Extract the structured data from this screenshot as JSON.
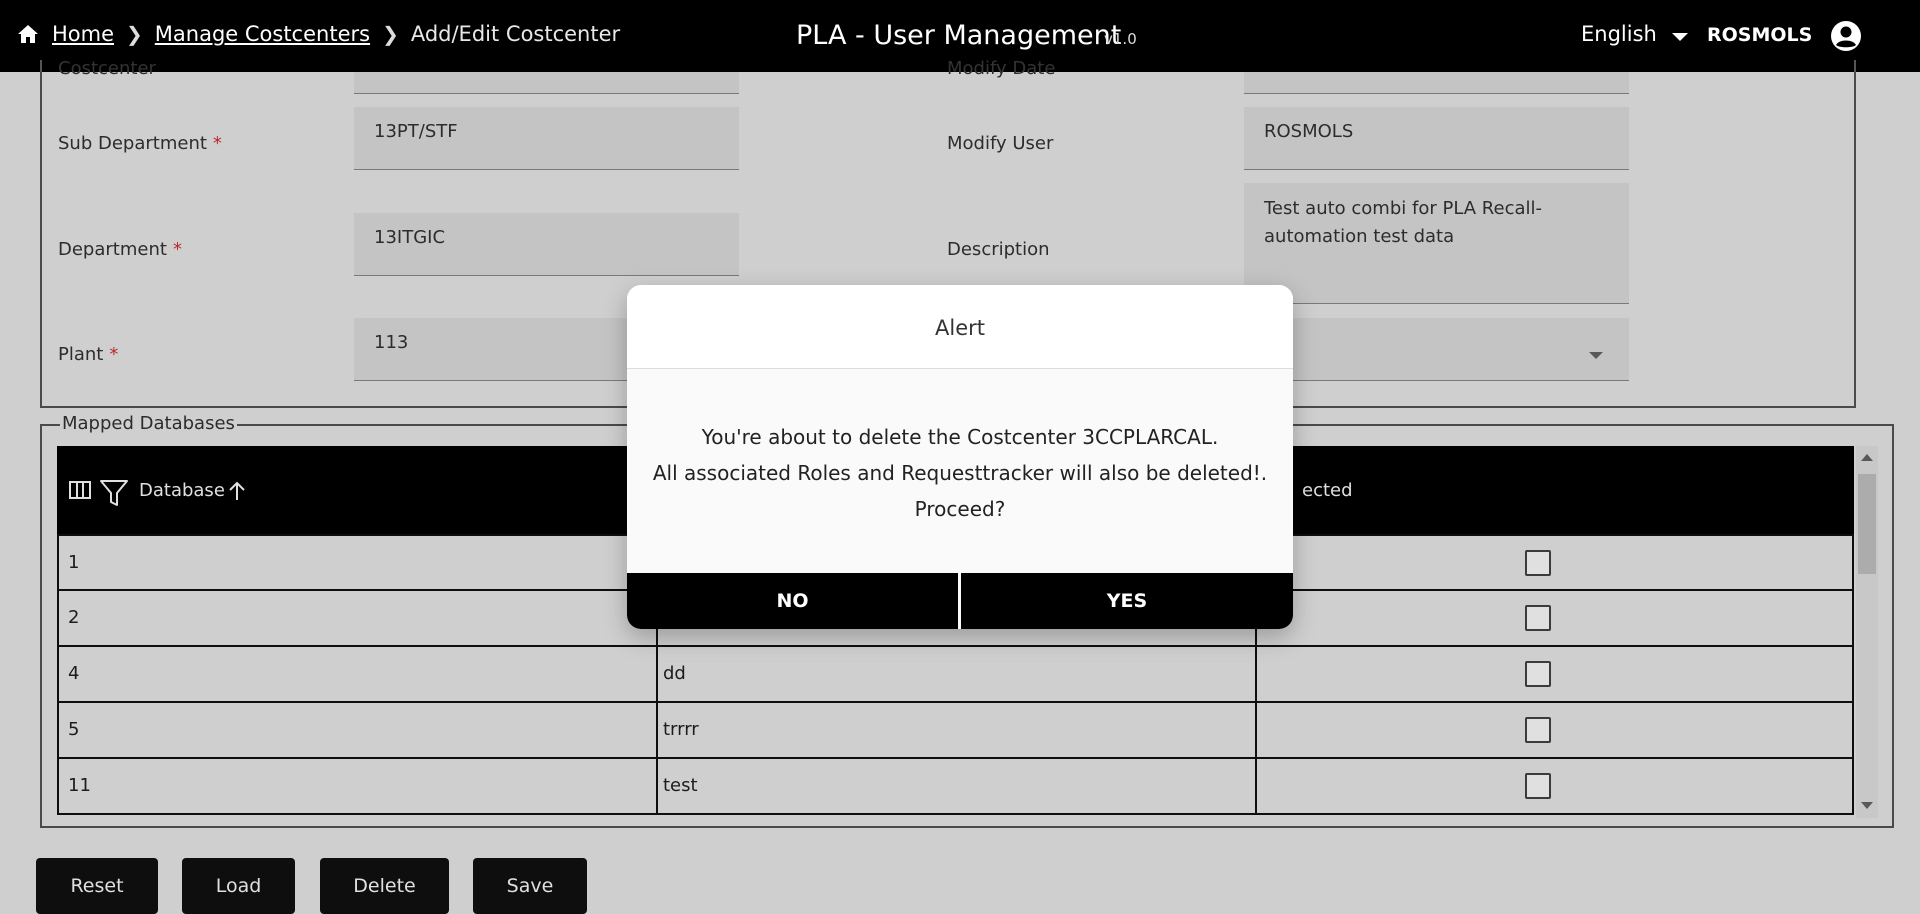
{
  "header": {
    "breadcrumb": {
      "home": "Home",
      "manage": "Manage Costcenters",
      "current": "Add/Edit Costcenter",
      "separator": "❯"
    },
    "title": "PLA - User Management",
    "version": "v1.0",
    "language": "English",
    "user": "ROSMOLS",
    "icons": [
      "home-icon",
      "chevron-down-icon",
      "account-circle-icon"
    ]
  },
  "form": {
    "costcenter_label": "Costcenter",
    "sub_department_label": "Sub Department",
    "sub_department_value": "13PT/STF",
    "department_label": "Department",
    "department_value": "13ITGIC",
    "plant_label": "Plant",
    "plant_value": "113",
    "modify_date_label": "Modify Date",
    "modify_user_label": "Modify User",
    "modify_user_value": "ROSMOLS",
    "description_label": "Description",
    "description_value": "Test auto combi for PLA Recall-automation test data",
    "required_mark": "*"
  },
  "mapped_databases": {
    "legend": "Mapped Databases",
    "columns": {
      "database": "Database",
      "selected_partial": "ected"
    },
    "rows": [
      {
        "id": "1",
        "name": ""
      },
      {
        "id": "2",
        "name": ""
      },
      {
        "id": "4",
        "name": "dd"
      },
      {
        "id": "5",
        "name": "trrrr"
      },
      {
        "id": "11",
        "name": "test"
      }
    ]
  },
  "actions": {
    "reset": "Reset",
    "load": "Load",
    "delete": "Delete",
    "save": "Save"
  },
  "dialog": {
    "title": "Alert",
    "line1": "You're about to delete the Costcenter 3CCPLARCAL.",
    "line2": "All associated Roles and Requesttracker will also be deleted!.",
    "line3": "Proceed?",
    "no": "NO",
    "yes": "YES"
  },
  "colors": {
    "header_bg": "#000000",
    "required": "#d32f2f",
    "field_bg": "#e0e0e0",
    "page_bg": "#ececec"
  }
}
